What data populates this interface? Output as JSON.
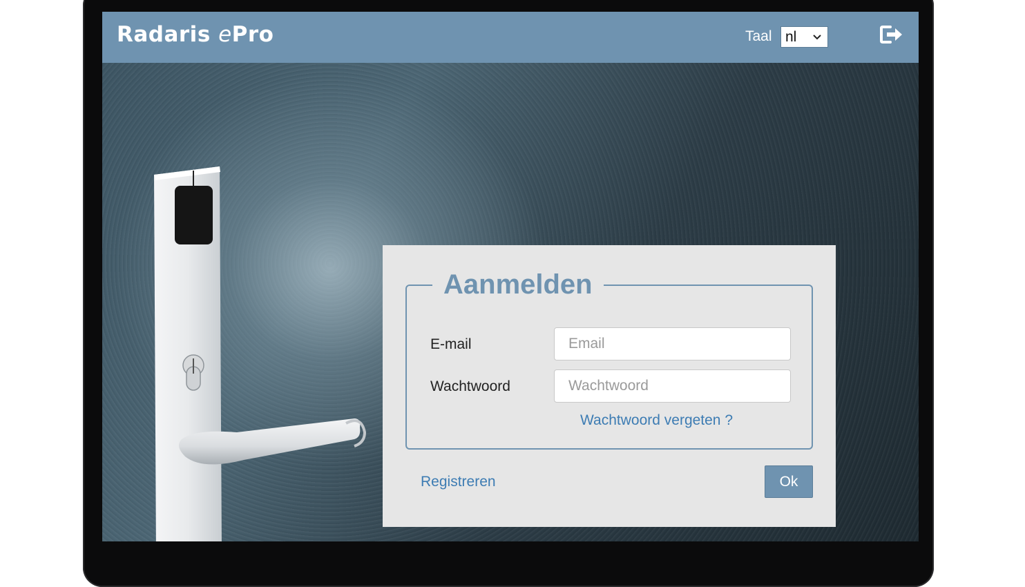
{
  "header": {
    "brand_main": "Radaris ",
    "brand_e": "e",
    "brand_pro": "Pro",
    "language_label": "Taal",
    "language_value": "nl",
    "logout_icon": "logout-icon"
  },
  "login": {
    "title": "Aanmelden",
    "email_label": "E-mail",
    "email_placeholder": "Email",
    "email_value": "",
    "password_label": "Wachtwoord",
    "password_placeholder": "Wachtwoord",
    "password_value": "",
    "forgot_link": "Wachtwoord vergeten ?",
    "register_link": "Registreren",
    "ok_button": "Ok"
  },
  "colors": {
    "header_bg": "#6f93b0",
    "panel_bg": "#e6e6e6",
    "link": "#3d7cb3"
  }
}
